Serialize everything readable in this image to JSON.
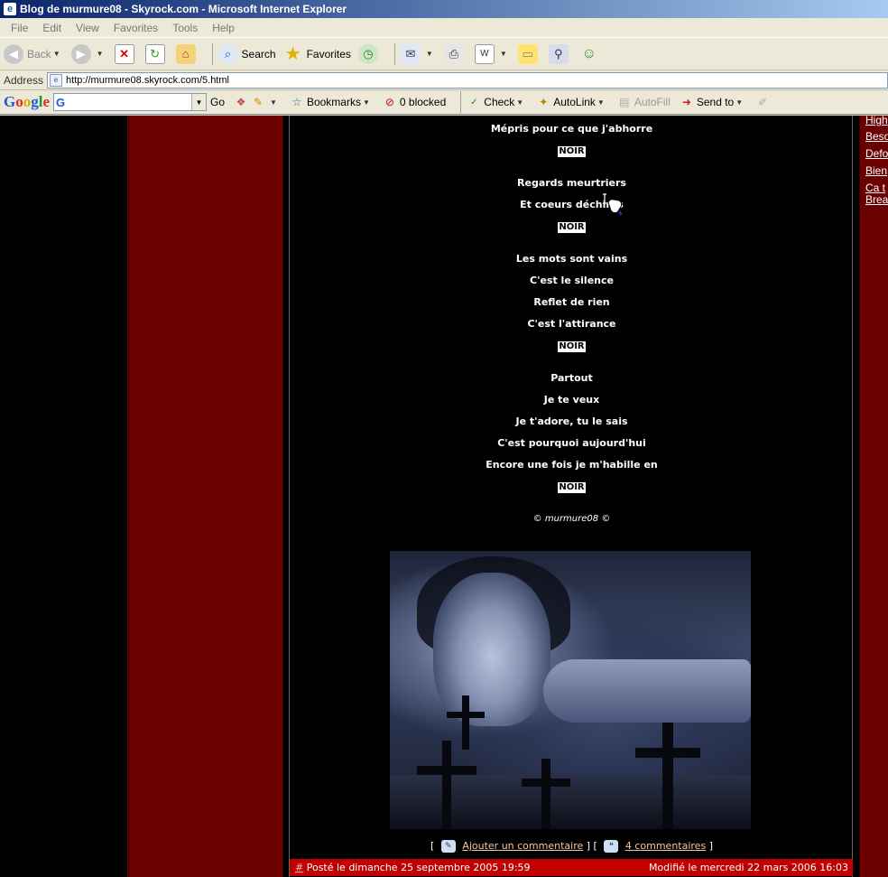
{
  "window": {
    "title": "Blog de murmure08 - Skyrock.com - Microsoft Internet Explorer"
  },
  "menu": {
    "items": [
      "File",
      "Edit",
      "View",
      "Favorites",
      "Tools",
      "Help"
    ]
  },
  "toolbar": {
    "back_label": "Back",
    "search_label": "Search",
    "favorites_label": "Favorites"
  },
  "address": {
    "label": "Address",
    "url": "http://murmure08.skyrock.com/5.html"
  },
  "googlebar": {
    "logo": "Google",
    "go_label": "Go",
    "bookmarks_label": "Bookmarks",
    "blocked_label": "0 blocked",
    "check_label": "Check",
    "autolink_label": "AutoLink",
    "autofill_label": "AutoFill",
    "sendto_label": "Send to"
  },
  "sidebar_right": {
    "links": [
      "High",
      "Beso",
      "Defo",
      "Bien",
      "Ca t",
      "Brea"
    ]
  },
  "poem": {
    "line_01": "Mépris pour ce que j'abhorre",
    "noir": "NOIR",
    "line_02": "Regards meurtriers",
    "line_03": "Et coeurs déchirés",
    "line_04": "Les mots sont vains",
    "line_05": "C'est le silence",
    "line_06": "Reflet de rien",
    "line_07": "C'est l'attirance",
    "line_08": "Partout",
    "line_09": "Je te veux",
    "line_10": "Je t'adore, tu le sais",
    "line_11": "C'est pourquoi aujourd'hui",
    "line_12": "Encore une fois je m'habille en",
    "copyright_symbol": "©",
    "author": "murmure08"
  },
  "comments": {
    "open_bracket": "[",
    "add_label": "Ajouter un commentaire",
    "middle_bracket": "] [",
    "count_label": "4 commentaires",
    "close_bracket": "]"
  },
  "footer": {
    "hash": "#",
    "posted": "Posté le dimanche 25 septembre 2005 19:59",
    "modified": "Modifié le mercredi 22 mars 2006 16:03"
  }
}
